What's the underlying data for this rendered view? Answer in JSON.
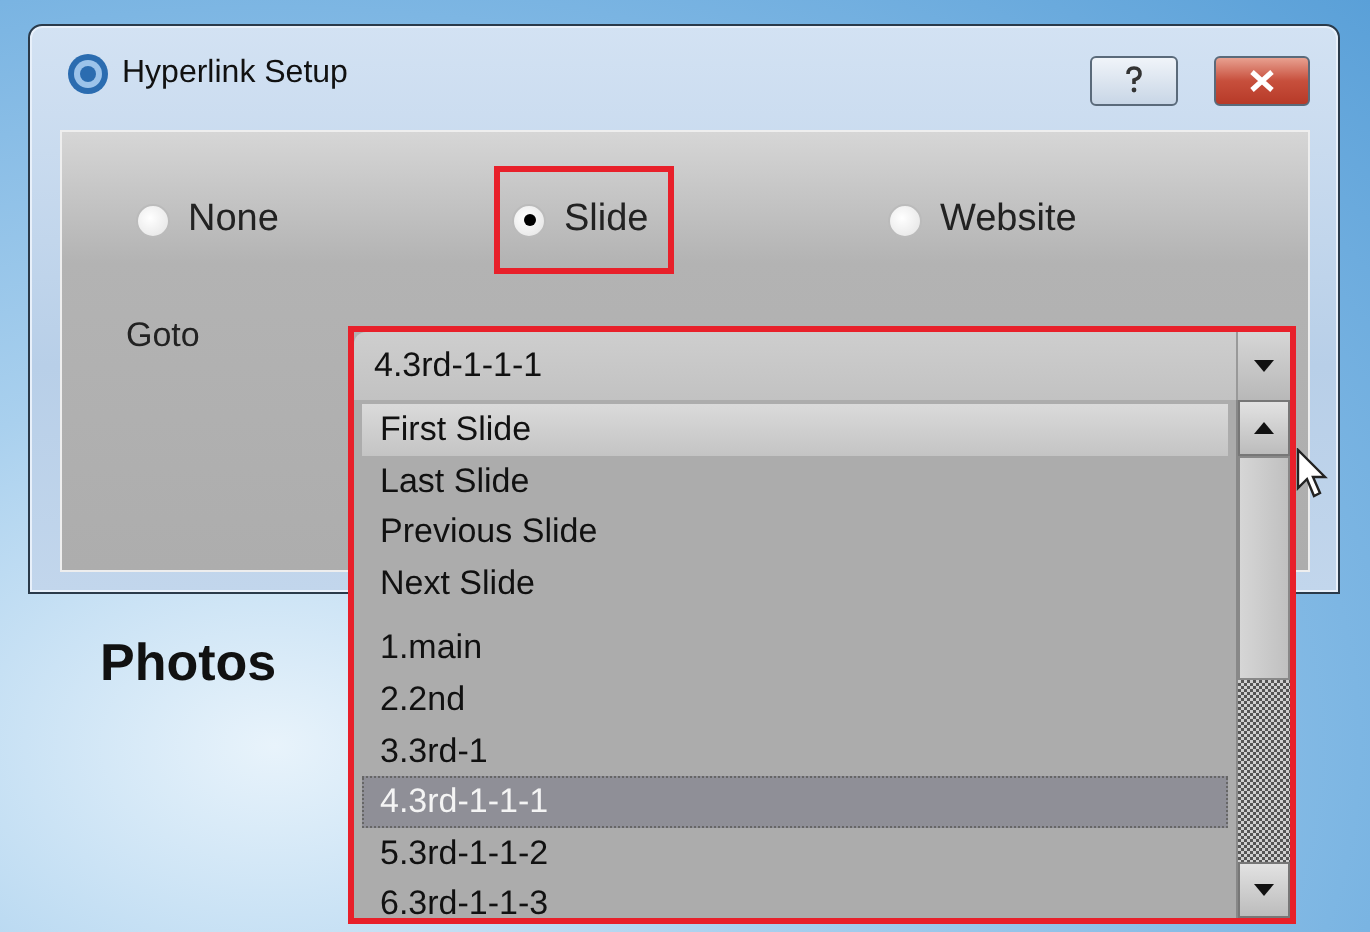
{
  "window": {
    "title": "Hyperlink Setup"
  },
  "link_type": [
    {
      "label": "None",
      "selected": false,
      "highlighted": false
    },
    {
      "label": "Slide",
      "selected": true,
      "highlighted": true
    },
    {
      "label": "Website",
      "selected": false,
      "highlighted": false
    }
  ],
  "goto": {
    "label": "Goto",
    "value": "4.3rd-1-1-1",
    "highlighted": true,
    "options": [
      [
        {
          "label": "First Slide",
          "selected": false
        },
        {
          "label": "Last Slide",
          "selected": false
        },
        {
          "label": "Previous Slide",
          "selected": false
        },
        {
          "label": "Next Slide",
          "selected": false
        }
      ],
      [
        {
          "label": "1.main",
          "selected": false
        },
        {
          "label": "2.2nd",
          "selected": false
        },
        {
          "label": "3.3rd-1",
          "selected": false
        },
        {
          "label": "4.3rd-1-1-1",
          "selected": true
        },
        {
          "label": "5.3rd-1-1-2",
          "selected": false
        },
        {
          "label": "6.3rd-1-1-3",
          "selected": false
        }
      ]
    ]
  },
  "background": {
    "heading": "Photos"
  }
}
